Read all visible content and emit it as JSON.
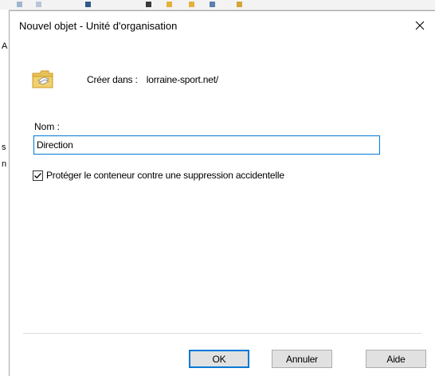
{
  "dialog": {
    "title": "Nouvel objet - Unité d'organisation",
    "create_in_label": "Créer dans :",
    "create_in_value": "lorraine-sport.net/",
    "name_label": "Nom :",
    "name_value": "Direction",
    "protect_label": "Protéger le conteneur contre une suppression accidentelle",
    "protect_checked": true,
    "buttons": {
      "ok": "OK",
      "cancel": "Annuler",
      "help": "Aide"
    }
  },
  "background": {
    "left_letters": [
      "A",
      "s",
      "n"
    ]
  },
  "icons": {
    "folder": "organizational-unit-folder-icon",
    "close": "close-icon",
    "check": "checkmark-icon"
  },
  "colors": {
    "accent": "#0078d7",
    "folder_fill": "#f2d06b",
    "folder_edge": "#c99a2e"
  }
}
